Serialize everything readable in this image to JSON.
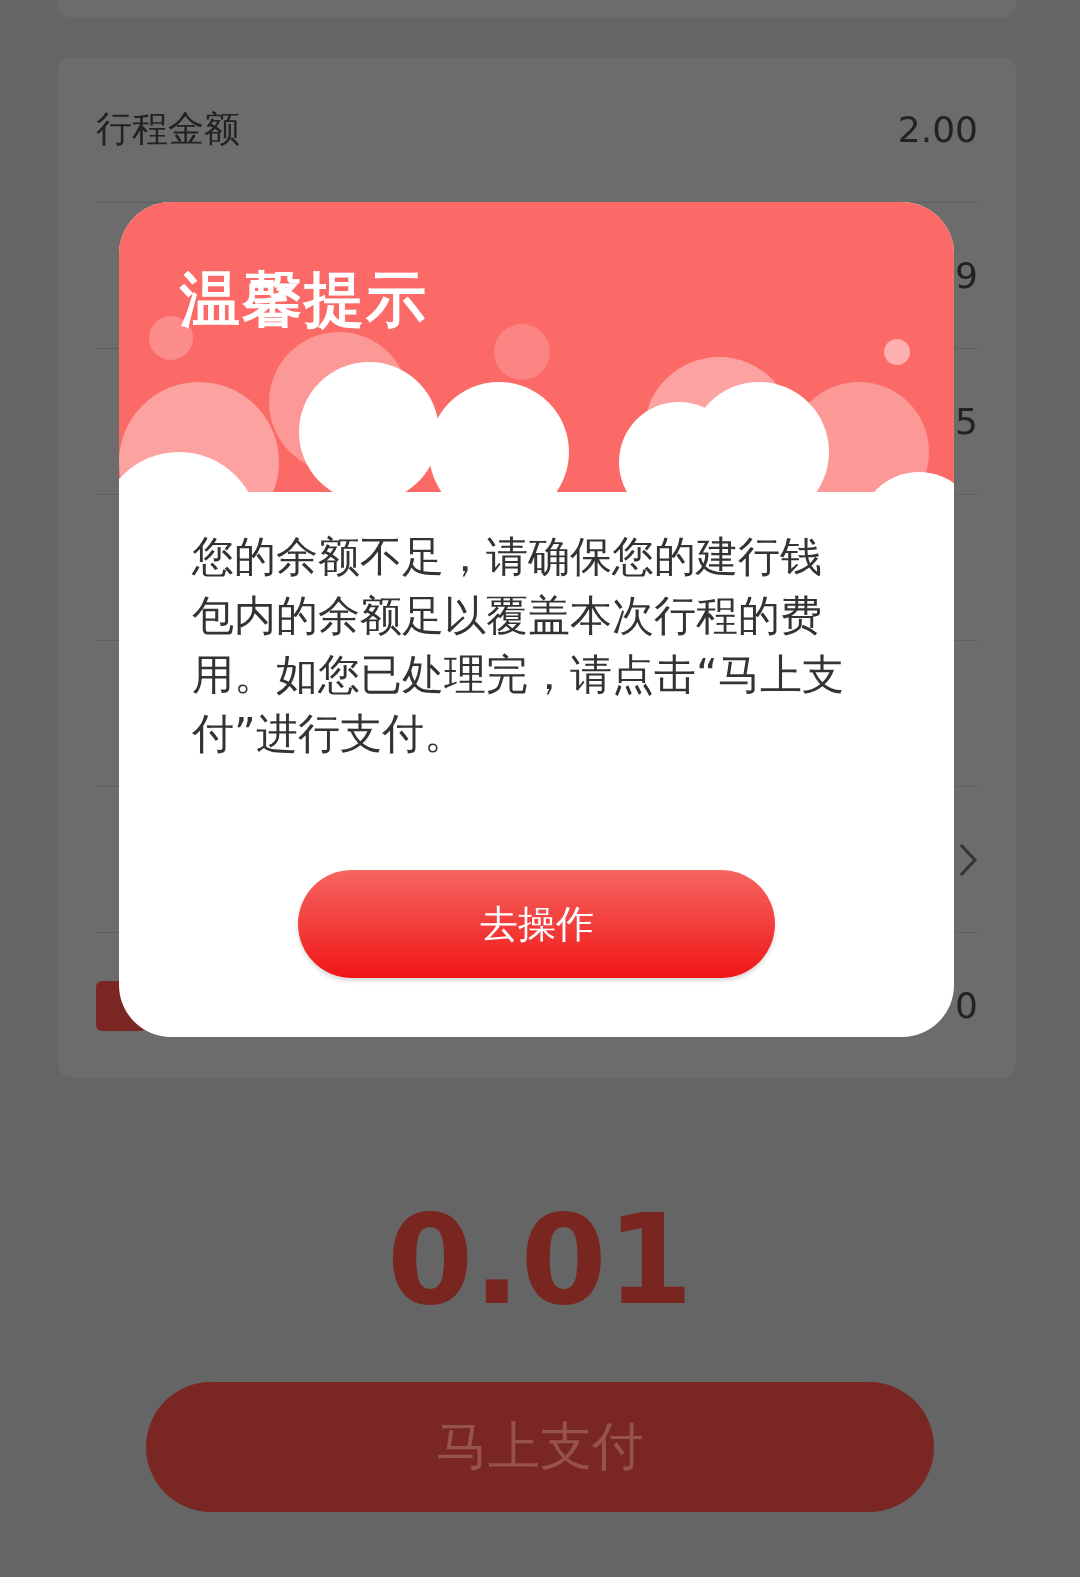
{
  "trip_rows": [
    {
      "kind": "text",
      "label": "行程金额",
      "value": "2.00"
    },
    {
      "kind": "text",
      "value": "9"
    },
    {
      "kind": "text",
      "value": "5"
    },
    {
      "kind": "text"
    },
    {
      "kind": "text"
    },
    {
      "kind": "chevron"
    },
    {
      "kind": "badge",
      "value": "0"
    }
  ],
  "amount": "0.01",
  "pay_button": "马上支付",
  "dialog": {
    "title": "温馨提示",
    "message": "您的余额不足，请确保您的建行钱包内的余额足以覆盖本次行程的费用。如您已处理完，请点击“马上支付”进行支付。",
    "button": "去操作"
  }
}
